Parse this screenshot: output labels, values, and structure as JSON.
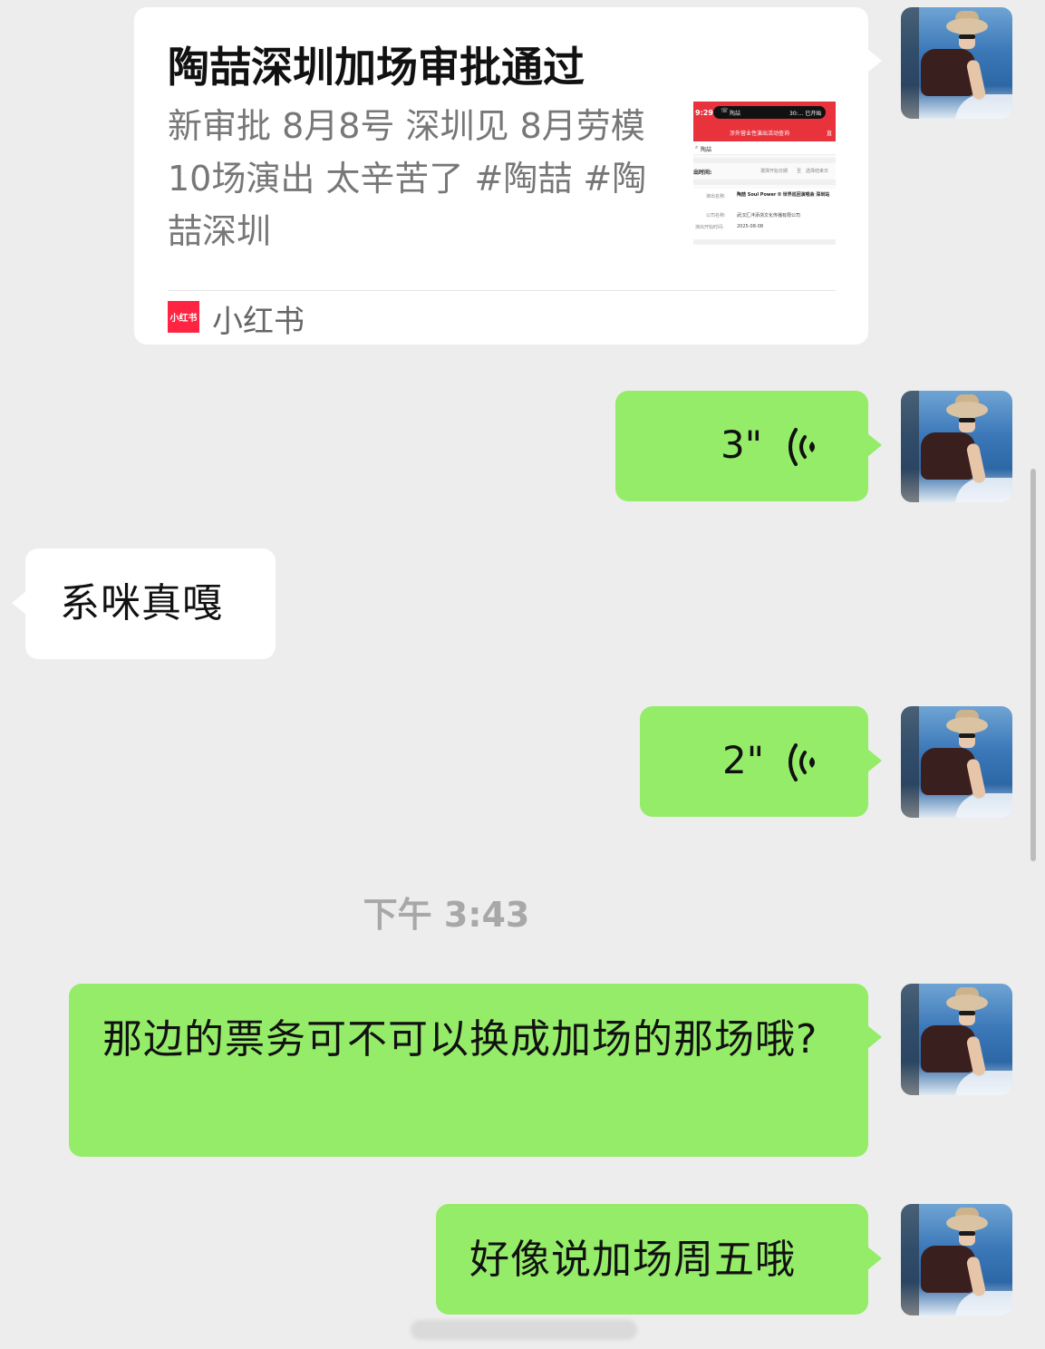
{
  "card": {
    "title": "陶喆深圳加场审批通过",
    "description": "新审批 8月8号 深圳见 8月劳模 10场演出 太辛苦了 #陶喆 #陶喆深圳",
    "source": "小红书",
    "logo_text": "小红书",
    "thumbnail": {
      "time": "9:29",
      "app_name": "陶喆",
      "call_time": "30:... 已开始",
      "banner": "涉外营业性演出活动查询",
      "banner_right": "直",
      "search_value": "陶喆",
      "row_label": "出时间:",
      "start_date_label": "選擇开始日期",
      "sep": "至",
      "end_date_label": "选择结束日",
      "detail": {
        "name_label": "演出名称:",
        "name_value": "陶喆 Soul Power II 世界巡回演唱会 深圳站",
        "company_label": "公司名称:",
        "company_value": "武汉汇沣添浙文化传播有限公司",
        "date_label": "演出开始时间:",
        "date_value": "2025-08-08"
      }
    }
  },
  "messages": [
    {
      "type": "voice",
      "side": "right",
      "duration": "3\""
    },
    {
      "type": "text",
      "side": "left",
      "text": "系咪真嘎"
    },
    {
      "type": "voice",
      "side": "right",
      "duration": "2\""
    },
    {
      "type": "text",
      "side": "right",
      "text": "那边的票务可不可以换成加场的那场哦?"
    },
    {
      "type": "text",
      "side": "right",
      "text": "好像说加场周五哦"
    }
  ],
  "timestamp": "下午 3:43",
  "colors": {
    "background": "#ededed",
    "sent_bubble": "#95ec69",
    "received_bubble": "#ffffff",
    "brand_red": "#ff2442"
  }
}
